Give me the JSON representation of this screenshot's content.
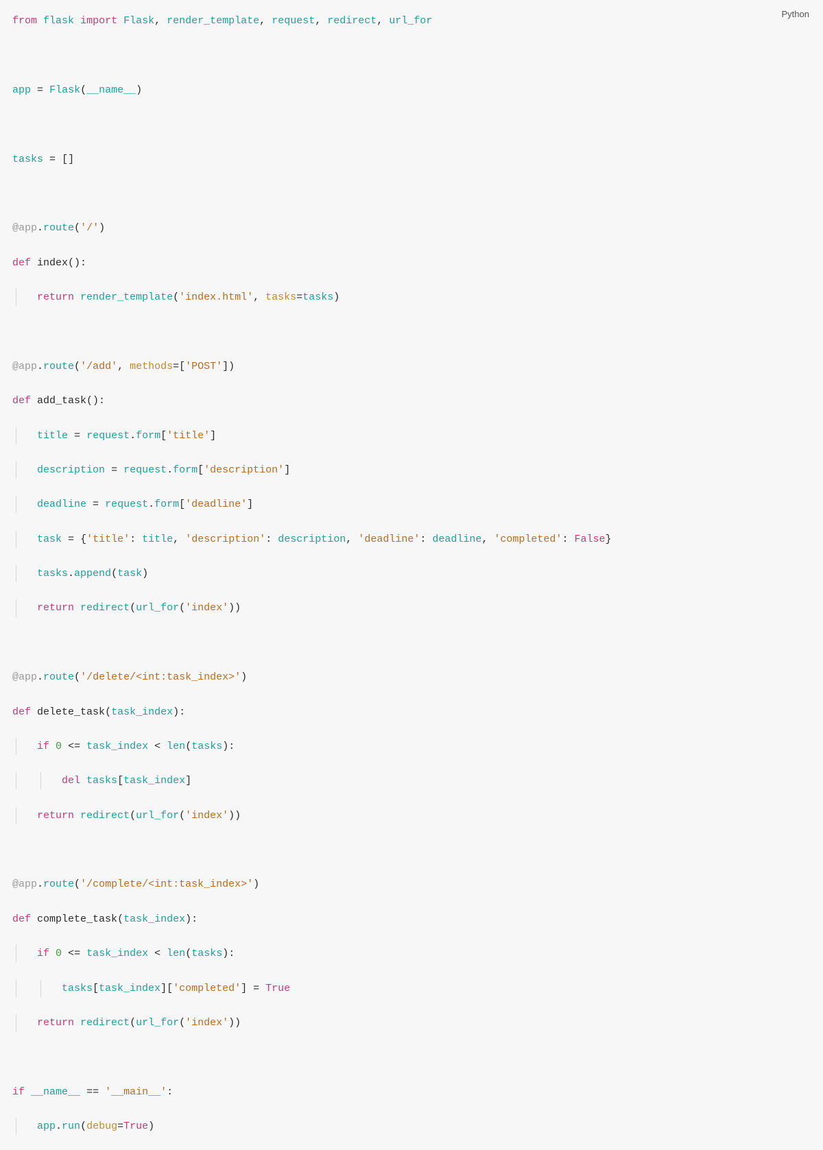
{
  "language_label": "Python",
  "code": {
    "lines": [
      "from flask import Flask, render_template, request, redirect, url_for",
      "",
      "app = Flask(__name__)",
      "",
      "tasks = []",
      "",
      "@app.route('/')",
      "def index():",
      "    return render_template('index.html', tasks=tasks)",
      "",
      "@app.route('/add', methods=['POST'])",
      "def add_task():",
      "    title = request.form['title']",
      "    description = request.form['description']",
      "    deadline = request.form['deadline']",
      "    task = {'title': title, 'description': description, 'deadline': deadline, 'completed': False}",
      "    tasks.append(task)",
      "    return redirect(url_for('index'))",
      "",
      "@app.route('/delete/<int:task_index>')",
      "def delete_task(task_index):",
      "    if 0 <= task_index < len(tasks):",
      "        del tasks[task_index]",
      "    return redirect(url_for('index'))",
      "",
      "@app.route('/complete/<int:task_index>')",
      "def complete_task(task_index):",
      "    if 0 <= task_index < len(tasks):",
      "        tasks[task_index]['completed'] = True",
      "    return redirect(url_for('index'))",
      "",
      "if __name__ == '__main__':",
      "    app.run(debug=True)"
    ]
  }
}
